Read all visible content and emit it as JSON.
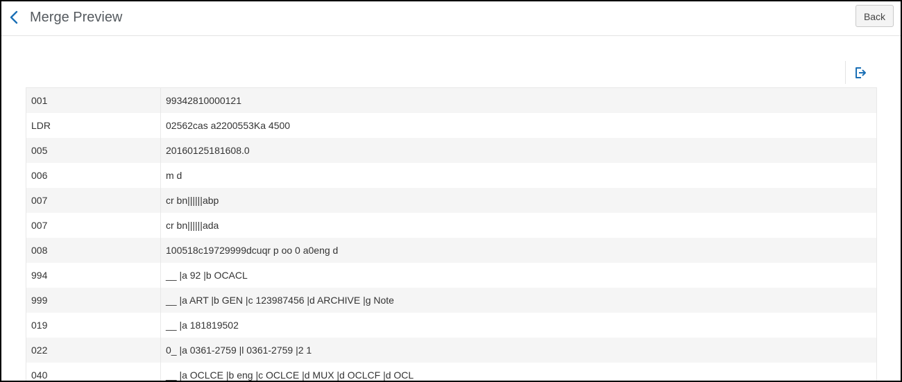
{
  "header": {
    "title": "Merge Preview",
    "back_button_label": "Back"
  },
  "toolbar": {
    "export_icon": "export-icon"
  },
  "colors": {
    "accent": "#1a6fb5",
    "row_alt": "#f5f5f5",
    "title_text": "#555a5f"
  },
  "records": [
    {
      "tag": "001",
      "value": "99342810000121"
    },
    {
      "tag": "LDR",
      "value": "02562cas a2200553Ka 4500"
    },
    {
      "tag": "005",
      "value": "20160125181608.0"
    },
    {
      "tag": "006",
      "value": "m d"
    },
    {
      "tag": "007",
      "value": "cr bn||||||abp"
    },
    {
      "tag": "007",
      "value": "cr bn||||||ada"
    },
    {
      "tag": "008",
      "value": "100518c19729999dcuqr p oo 0 a0eng d"
    },
    {
      "tag": "994",
      "value": "__ |a 92 |b OCACL"
    },
    {
      "tag": "999",
      "value": "__ |a ART |b GEN |c 123987456 |d ARCHIVE |g Note"
    },
    {
      "tag": "019",
      "value": "__ |a 181819502"
    },
    {
      "tag": "022",
      "value": "0_ |a 0361-2759 |l 0361-2759 |2 1"
    },
    {
      "tag": "040",
      "value": "__ |a OCLCE |b eng |c OCLCE |d MUX |d OCLCF |d OCL"
    }
  ]
}
